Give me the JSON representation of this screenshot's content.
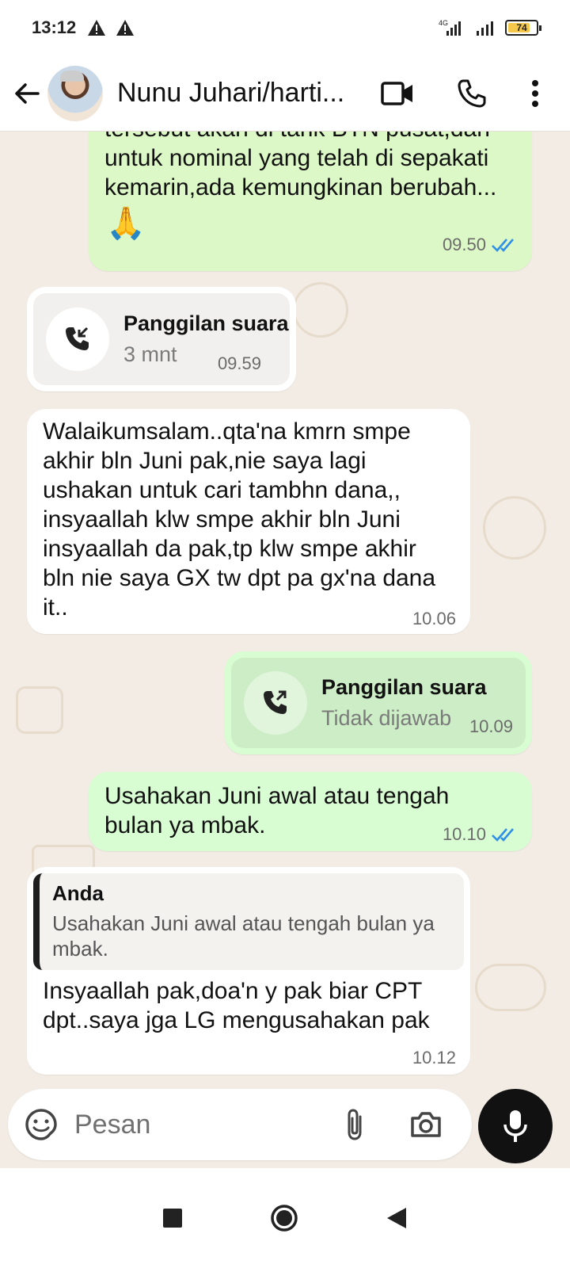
{
  "status_bar": {
    "time": "13:12",
    "network": "4G",
    "battery": "74"
  },
  "header": {
    "contact_name": "Nunu Juhari/harti...",
    "back_icon": "arrow-back-icon",
    "video_icon": "video-call-icon",
    "call_icon": "phone-icon",
    "more_icon": "more-vert-icon"
  },
  "messages": [
    {
      "type": "text",
      "direction": "outgoing",
      "text": "tersebut akan di tarik BTN pusat,dan\nuntuk nominal yang telah di sepakati\nkemarin,ada kemungkinan berubah...",
      "emoji": "🙏",
      "time": "09.50",
      "read": true
    },
    {
      "type": "call",
      "direction": "incoming",
      "title": "Panggilan suara",
      "subtitle": "3 mnt",
      "time": "09.59"
    },
    {
      "type": "text",
      "direction": "incoming",
      "text": "Walaikumsalam..qta'na kmrn smpe\nakhir bln Juni pak,nie saya lagi\nushakan untuk cari tambhn dana,,\ninsyaallah klw smpe akhir bln Juni\ninsyaallah da pak,tp klw smpe akhir\nbln nie saya GX tw dpt pa gx'na dana\nit..",
      "time": "10.06"
    },
    {
      "type": "call",
      "direction": "outgoing",
      "title": "Panggilan suara",
      "subtitle": "Tidak dijawab",
      "time": "10.09"
    },
    {
      "type": "text",
      "direction": "outgoing",
      "text": "Usahakan Juni awal atau tengah\nbulan ya mbak.",
      "time": "10.10",
      "read": true
    },
    {
      "type": "reply",
      "direction": "incoming",
      "quote_author": "Anda",
      "quote_text": "Usahakan Juni awal atau tengah bulan ya\nmbak.",
      "text": "Insyaallah pak,doa'n y pak biar CPT\ndpt..saya jga LG mengusahakan pak",
      "time": "10.12"
    }
  ],
  "composer": {
    "placeholder": "Pesan"
  },
  "colors": {
    "outgoing_bubble": "#dcf8c6",
    "incoming_bubble": "#ffffff",
    "read_ticks": "#2f8fe8",
    "background": "#f2ece4"
  }
}
